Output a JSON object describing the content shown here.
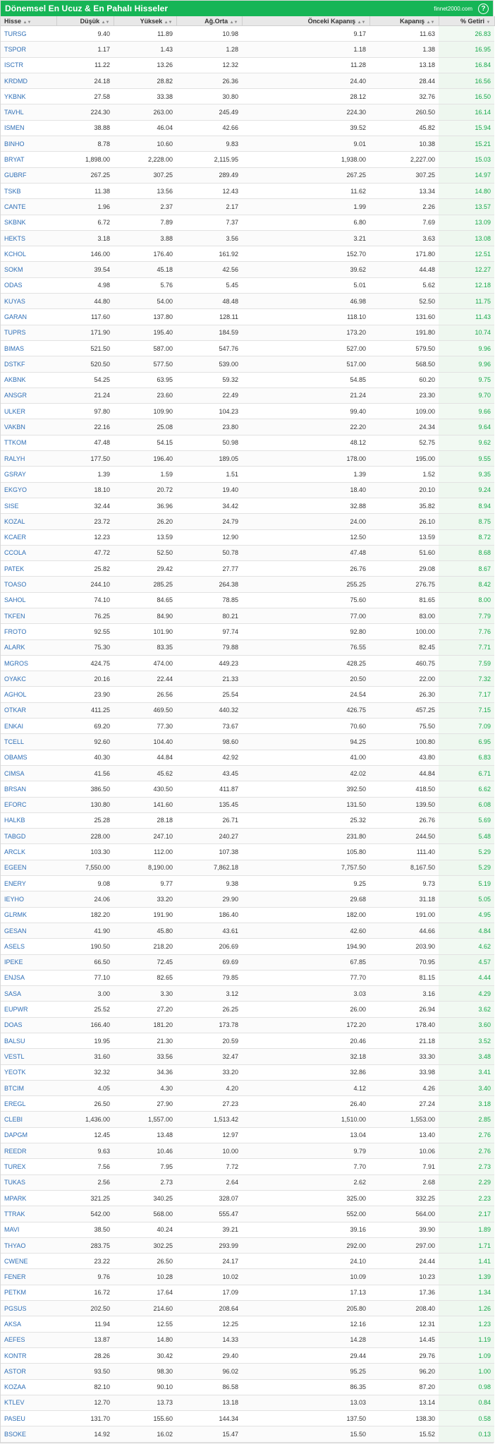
{
  "header": {
    "title": "Dönemsel En Ucuz & En Pahalı Hisseler",
    "brand": "finnet2000.com",
    "help_icon": "?"
  },
  "table": {
    "columns": [
      "Hisse",
      "Düşük",
      "Yüksek",
      "Ağ.Orta",
      "Önceki Kapanış",
      "Kapanış",
      "% Getiri"
    ],
    "rows": [
      [
        "TURSG",
        "9.40",
        "11.89",
        "10.98",
        "9.17",
        "11.63",
        "26.83"
      ],
      [
        "TSPOR",
        "1.17",
        "1.43",
        "1.28",
        "1.18",
        "1.38",
        "16.95"
      ],
      [
        "ISCTR",
        "11.22",
        "13.26",
        "12.32",
        "11.28",
        "13.18",
        "16.84"
      ],
      [
        "KRDMD",
        "24.18",
        "28.82",
        "26.36",
        "24.40",
        "28.44",
        "16.56"
      ],
      [
        "YKBNK",
        "27.58",
        "33.38",
        "30.80",
        "28.12",
        "32.76",
        "16.50"
      ],
      [
        "TAVHL",
        "224.30",
        "263.00",
        "245.49",
        "224.30",
        "260.50",
        "16.14"
      ],
      [
        "ISMEN",
        "38.88",
        "46.04",
        "42.66",
        "39.52",
        "45.82",
        "15.94"
      ],
      [
        "BINHO",
        "8.78",
        "10.60",
        "9.83",
        "9.01",
        "10.38",
        "15.21"
      ],
      [
        "BRYAT",
        "1,898.00",
        "2,228.00",
        "2,115.95",
        "1,938.00",
        "2,227.00",
        "15.03"
      ],
      [
        "GUBRF",
        "267.25",
        "307.25",
        "289.49",
        "267.25",
        "307.25",
        "14.97"
      ],
      [
        "TSKB",
        "11.38",
        "13.56",
        "12.43",
        "11.62",
        "13.34",
        "14.80"
      ],
      [
        "CANTE",
        "1.96",
        "2.37",
        "2.17",
        "1.99",
        "2.26",
        "13.57"
      ],
      [
        "SKBNK",
        "6.72",
        "7.89",
        "7.37",
        "6.80",
        "7.69",
        "13.09"
      ],
      [
        "HEKTS",
        "3.18",
        "3.88",
        "3.56",
        "3.21",
        "3.63",
        "13.08"
      ],
      [
        "KCHOL",
        "146.00",
        "176.40",
        "161.92",
        "152.70",
        "171.80",
        "12.51"
      ],
      [
        "SOKM",
        "39.54",
        "45.18",
        "42.56",
        "39.62",
        "44.48",
        "12.27"
      ],
      [
        "ODAS",
        "4.98",
        "5.76",
        "5.45",
        "5.01",
        "5.62",
        "12.18"
      ],
      [
        "KUYAS",
        "44.80",
        "54.00",
        "48.48",
        "46.98",
        "52.50",
        "11.75"
      ],
      [
        "GARAN",
        "117.60",
        "137.80",
        "128.11",
        "118.10",
        "131.60",
        "11.43"
      ],
      [
        "TUPRS",
        "171.90",
        "195.40",
        "184.59",
        "173.20",
        "191.80",
        "10.74"
      ],
      [
        "BIMAS",
        "521.50",
        "587.00",
        "547.76",
        "527.00",
        "579.50",
        "9.96"
      ],
      [
        "DSTKF",
        "520.50",
        "577.50",
        "539.00",
        "517.00",
        "568.50",
        "9.96"
      ],
      [
        "AKBNK",
        "54.25",
        "63.95",
        "59.32",
        "54.85",
        "60.20",
        "9.75"
      ],
      [
        "ANSGR",
        "21.24",
        "23.60",
        "22.49",
        "21.24",
        "23.30",
        "9.70"
      ],
      [
        "ULKER",
        "97.80",
        "109.90",
        "104.23",
        "99.40",
        "109.00",
        "9.66"
      ],
      [
        "VAKBN",
        "22.16",
        "25.08",
        "23.80",
        "22.20",
        "24.34",
        "9.64"
      ],
      [
        "TTKOM",
        "47.48",
        "54.15",
        "50.98",
        "48.12",
        "52.75",
        "9.62"
      ],
      [
        "RALYH",
        "177.50",
        "196.40",
        "189.05",
        "178.00",
        "195.00",
        "9.55"
      ],
      [
        "GSRAY",
        "1.39",
        "1.59",
        "1.51",
        "1.39",
        "1.52",
        "9.35"
      ],
      [
        "EKGYO",
        "18.10",
        "20.72",
        "19.40",
        "18.40",
        "20.10",
        "9.24"
      ],
      [
        "SISE",
        "32.44",
        "36.96",
        "34.42",
        "32.88",
        "35.82",
        "8.94"
      ],
      [
        "KOZAL",
        "23.72",
        "26.20",
        "24.79",
        "24.00",
        "26.10",
        "8.75"
      ],
      [
        "KCAER",
        "12.23",
        "13.59",
        "12.90",
        "12.50",
        "13.59",
        "8.72"
      ],
      [
        "CCOLA",
        "47.72",
        "52.50",
        "50.78",
        "47.48",
        "51.60",
        "8.68"
      ],
      [
        "PATEK",
        "25.82",
        "29.42",
        "27.77",
        "26.76",
        "29.08",
        "8.67"
      ],
      [
        "TOASO",
        "244.10",
        "285.25",
        "264.38",
        "255.25",
        "276.75",
        "8.42"
      ],
      [
        "SAHOL",
        "74.10",
        "84.65",
        "78.85",
        "75.60",
        "81.65",
        "8.00"
      ],
      [
        "TKFEN",
        "76.25",
        "84.90",
        "80.21",
        "77.00",
        "83.00",
        "7.79"
      ],
      [
        "FROTO",
        "92.55",
        "101.90",
        "97.74",
        "92.80",
        "100.00",
        "7.76"
      ],
      [
        "ALARK",
        "75.30",
        "83.35",
        "79.88",
        "76.55",
        "82.45",
        "7.71"
      ],
      [
        "MGROS",
        "424.75",
        "474.00",
        "449.23",
        "428.25",
        "460.75",
        "7.59"
      ],
      [
        "OYAKC",
        "20.16",
        "22.44",
        "21.33",
        "20.50",
        "22.00",
        "7.32"
      ],
      [
        "AGHOL",
        "23.90",
        "26.56",
        "25.54",
        "24.54",
        "26.30",
        "7.17"
      ],
      [
        "OTKAR",
        "411.25",
        "469.50",
        "440.32",
        "426.75",
        "457.25",
        "7.15"
      ],
      [
        "ENKAI",
        "69.20",
        "77.30",
        "73.67",
        "70.60",
        "75.50",
        "7.09"
      ],
      [
        "TCELL",
        "92.60",
        "104.40",
        "98.60",
        "94.25",
        "100.80",
        "6.95"
      ],
      [
        "OBAMS",
        "40.30",
        "44.84",
        "42.92",
        "41.00",
        "43.80",
        "6.83"
      ],
      [
        "CIMSA",
        "41.56",
        "45.62",
        "43.45",
        "42.02",
        "44.84",
        "6.71"
      ],
      [
        "BRSAN",
        "386.50",
        "430.50",
        "411.87",
        "392.50",
        "418.50",
        "6.62"
      ],
      [
        "EFORC",
        "130.80",
        "141.60",
        "135.45",
        "131.50",
        "139.50",
        "6.08"
      ],
      [
        "HALKB",
        "25.28",
        "28.18",
        "26.71",
        "25.32",
        "26.76",
        "5.69"
      ],
      [
        "TABGD",
        "228.00",
        "247.10",
        "240.27",
        "231.80",
        "244.50",
        "5.48"
      ],
      [
        "ARCLK",
        "103.30",
        "112.00",
        "107.38",
        "105.80",
        "111.40",
        "5.29"
      ],
      [
        "EGEEN",
        "7,550.00",
        "8,190.00",
        "7,862.18",
        "7,757.50",
        "8,167.50",
        "5.29"
      ],
      [
        "ENERY",
        "9.08",
        "9.77",
        "9.38",
        "9.25",
        "9.73",
        "5.19"
      ],
      [
        "IEYHO",
        "24.06",
        "33.20",
        "29.90",
        "29.68",
        "31.18",
        "5.05"
      ],
      [
        "GLRMK",
        "182.20",
        "191.90",
        "186.40",
        "182.00",
        "191.00",
        "4.95"
      ],
      [
        "GESAN",
        "41.90",
        "45.80",
        "43.61",
        "42.60",
        "44.66",
        "4.84"
      ],
      [
        "ASELS",
        "190.50",
        "218.20",
        "206.69",
        "194.90",
        "203.90",
        "4.62"
      ],
      [
        "IPEKE",
        "66.50",
        "72.45",
        "69.69",
        "67.85",
        "70.95",
        "4.57"
      ],
      [
        "ENJSA",
        "77.10",
        "82.65",
        "79.85",
        "77.70",
        "81.15",
        "4.44"
      ],
      [
        "SASA",
        "3.00",
        "3.30",
        "3.12",
        "3.03",
        "3.16",
        "4.29"
      ],
      [
        "EUPWR",
        "25.52",
        "27.20",
        "26.25",
        "26.00",
        "26.94",
        "3.62"
      ],
      [
        "DOAS",
        "166.40",
        "181.20",
        "173.78",
        "172.20",
        "178.40",
        "3.60"
      ],
      [
        "BALSU",
        "19.95",
        "21.30",
        "20.59",
        "20.46",
        "21.18",
        "3.52"
      ],
      [
        "VESTL",
        "31.60",
        "33.56",
        "32.47",
        "32.18",
        "33.30",
        "3.48"
      ],
      [
        "YEOTK",
        "32.32",
        "34.36",
        "33.20",
        "32.86",
        "33.98",
        "3.41"
      ],
      [
        "BTCIM",
        "4.05",
        "4.30",
        "4.20",
        "4.12",
        "4.26",
        "3.40"
      ],
      [
        "EREGL",
        "26.50",
        "27.90",
        "27.23",
        "26.40",
        "27.24",
        "3.18"
      ],
      [
        "CLEBI",
        "1,436.00",
        "1,557.00",
        "1,513.42",
        "1,510.00",
        "1,553.00",
        "2.85"
      ],
      [
        "DAPGM",
        "12.45",
        "13.48",
        "12.97",
        "13.04",
        "13.40",
        "2.76"
      ],
      [
        "REEDR",
        "9.63",
        "10.46",
        "10.00",
        "9.79",
        "10.06",
        "2.76"
      ],
      [
        "TUREX",
        "7.56",
        "7.95",
        "7.72",
        "7.70",
        "7.91",
        "2.73"
      ],
      [
        "TUKAS",
        "2.56",
        "2.73",
        "2.64",
        "2.62",
        "2.68",
        "2.29"
      ],
      [
        "MPARK",
        "321.25",
        "340.25",
        "328.07",
        "325.00",
        "332.25",
        "2.23"
      ],
      [
        "TTRAK",
        "542.00",
        "568.00",
        "555.47",
        "552.00",
        "564.00",
        "2.17"
      ],
      [
        "MAVI",
        "38.50",
        "40.24",
        "39.21",
        "39.16",
        "39.90",
        "1.89"
      ],
      [
        "THYAO",
        "283.75",
        "302.25",
        "293.99",
        "292.00",
        "297.00",
        "1.71"
      ],
      [
        "CWENE",
        "23.22",
        "26.50",
        "24.17",
        "24.10",
        "24.44",
        "1.41"
      ],
      [
        "FENER",
        "9.76",
        "10.28",
        "10.02",
        "10.09",
        "10.23",
        "1.39"
      ],
      [
        "PETKM",
        "16.72",
        "17.64",
        "17.09",
        "17.13",
        "17.36",
        "1.34"
      ],
      [
        "PGSUS",
        "202.50",
        "214.60",
        "208.64",
        "205.80",
        "208.40",
        "1.26"
      ],
      [
        "AKSA",
        "11.94",
        "12.55",
        "12.25",
        "12.16",
        "12.31",
        "1.23"
      ],
      [
        "AEFES",
        "13.87",
        "14.80",
        "14.33",
        "14.28",
        "14.45",
        "1.19"
      ],
      [
        "KONTR",
        "28.26",
        "30.42",
        "29.40",
        "29.44",
        "29.76",
        "1.09"
      ],
      [
        "ASTOR",
        "93.50",
        "98.30",
        "96.02",
        "95.25",
        "96.20",
        "1.00"
      ],
      [
        "KOZAA",
        "82.10",
        "90.10",
        "86.58",
        "86.35",
        "87.20",
        "0.98"
      ],
      [
        "KTLEV",
        "12.70",
        "13.73",
        "13.18",
        "13.03",
        "13.14",
        "0.84"
      ],
      [
        "PASEU",
        "131.70",
        "155.60",
        "144.34",
        "137.50",
        "138.30",
        "0.58"
      ],
      [
        "BSOKE",
        "14.92",
        "16.02",
        "15.47",
        "15.50",
        "15.52",
        "0.13"
      ]
    ]
  }
}
